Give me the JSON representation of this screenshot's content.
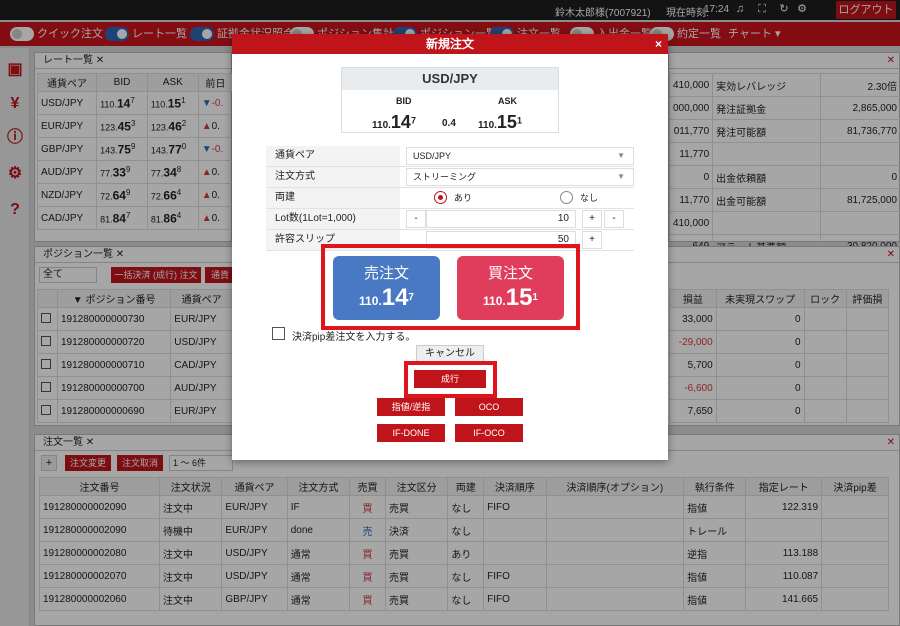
{
  "topbar": {
    "user": "鈴木太郎様(7007921)",
    "time_label": "現在時刻:",
    "time": "17:24",
    "logout": "ログアウト"
  },
  "toolbar": {
    "toggles": [
      {
        "label": "クイック注文",
        "on": false
      },
      {
        "label": "レート一覧",
        "on": true
      },
      {
        "label": "証拠金状況照会",
        "on": true
      },
      {
        "label": "ポジション集計",
        "on": false
      },
      {
        "label": "ポジション一覧",
        "on": true
      },
      {
        "label": "注文一覧",
        "on": true
      },
      {
        "label": "入出金一覧",
        "on": false
      },
      {
        "label": "約定一覧",
        "on": false
      }
    ],
    "chart": "チャート"
  },
  "rates": {
    "title": "レート一覧",
    "headers": [
      "通貨ペア",
      "BID",
      "ASK",
      "前日"
    ],
    "rows": [
      {
        "pair": "USD/JPY",
        "bid_big": "110.",
        "bid_small": "14",
        "bid_sup": "7",
        "ask_big": "110.",
        "ask_small": "15",
        "ask_sup": "1",
        "dir": "down",
        "chg": "-0."
      },
      {
        "pair": "EUR/JPY",
        "bid_big": "123.",
        "bid_small": "45",
        "bid_sup": "3",
        "ask_big": "123.",
        "ask_small": "46",
        "ask_sup": "2",
        "dir": "up",
        "chg": "0."
      },
      {
        "pair": "GBP/JPY",
        "bid_big": "143.",
        "bid_small": "75",
        "bid_sup": "9",
        "ask_big": "143.",
        "ask_small": "77",
        "ask_sup": "0",
        "dir": "down",
        "chg": "-0."
      },
      {
        "pair": "AUD/JPY",
        "bid_big": "77.",
        "bid_small": "33",
        "bid_sup": "9",
        "ask_big": "77.",
        "ask_small": "34",
        "ask_sup": "8",
        "dir": "up",
        "chg": "0."
      },
      {
        "pair": "NZD/JPY",
        "bid_big": "72.",
        "bid_small": "64",
        "bid_sup": "9",
        "ask_big": "72.",
        "ask_small": "66",
        "ask_sup": "4",
        "dir": "up",
        "chg": "0."
      },
      {
        "pair": "CAD/JPY",
        "bid_big": "81.",
        "bid_small": "84",
        "bid_sup": "7",
        "ask_big": "81.",
        "ask_small": "86",
        "ask_sup": "4",
        "dir": "up",
        "chg": "0."
      }
    ]
  },
  "margin": {
    "rows": [
      {
        "v1": "410,000",
        "k2": "実効レバレッジ",
        "v2": "2.30倍"
      },
      {
        "v1": "000,000",
        "k2": "発注証拠金",
        "v2": "2,865,000"
      },
      {
        "v1": "011,770",
        "k2": "発注可能額",
        "v2": "81,736,770"
      },
      {
        "v1": "11,770",
        "k2": "",
        "v2": ""
      },
      {
        "v1": "0",
        "k2": "出金依頼額",
        "v2": "0"
      },
      {
        "v1": "11,770",
        "k2": "出金可能額",
        "v2": "81,725,000"
      },
      {
        "v1": "410,000",
        "k2": "",
        "v2": ""
      },
      {
        "v1": "649",
        "k2": "アラート基準額",
        "v2": "30,820,000"
      }
    ]
  },
  "positions": {
    "title": "ポジション一覧",
    "filter": "全て",
    "bulk_button": "一括決済 (成行) 注文",
    "currency_button": "通貨",
    "headers": [
      "▼ ポジション番号",
      "通貨ペア"
    ],
    "right_headers": [
      "損益",
      "未実現スワップ",
      "ロック",
      "評価損"
    ],
    "rows": [
      {
        "id": "191280000000730",
        "pair": "EUR/JPY",
        "pl": "33,000",
        "pl_neg": false,
        "swap": "0"
      },
      {
        "id": "191280000000720",
        "pair": "USD/JPY",
        "pl": "-29,000",
        "pl_neg": true,
        "swap": "0"
      },
      {
        "id": "191280000000710",
        "pair": "CAD/JPY",
        "pl": "5,700",
        "pl_neg": false,
        "swap": "0"
      },
      {
        "id": "191280000000700",
        "pair": "AUD/JPY",
        "pl": "-6,600",
        "pl_neg": true,
        "swap": "0"
      },
      {
        "id": "191280000000690",
        "pair": "EUR/JPY",
        "pl": "7,650",
        "pl_neg": false,
        "swap": "0"
      }
    ]
  },
  "orders": {
    "title": "注文一覧",
    "plus": "+",
    "change_button": "注文変更",
    "cancel_button": "注文取消",
    "count_select": "1 ～ 6件",
    "headers": [
      "注文番号",
      "注文状況",
      "通貨ペア",
      "注文方式",
      "売買",
      "注文区分",
      "両建",
      "決済順序",
      "決済順序(オプション)",
      "執行条件",
      "指定レート",
      "決済pip差"
    ],
    "rows": [
      {
        "id": "191280000002090",
        "status": "注文中",
        "pair": "EUR/JPY",
        "method": "IF",
        "side": "買",
        "kind": "売買",
        "hedge": "なし",
        "order": "FIFO",
        "cond": "指値",
        "rate": "122.319"
      },
      {
        "id": "191280000002090",
        "status": "待機中",
        "pair": "EUR/JPY",
        "method": "done",
        "side": "売",
        "kind": "決済",
        "hedge": "なし",
        "order": "",
        "cond": "トレール",
        "rate": ""
      },
      {
        "id": "191280000002080",
        "status": "注文中",
        "pair": "USD/JPY",
        "method": "通常",
        "side": "買",
        "kind": "売買",
        "hedge": "あり",
        "order": "",
        "cond": "逆指",
        "rate": "113.188"
      },
      {
        "id": "191280000002070",
        "status": "注文中",
        "pair": "USD/JPY",
        "method": "通常",
        "side": "買",
        "kind": "売買",
        "hedge": "なし",
        "order": "FIFO",
        "cond": "指値",
        "rate": "110.087"
      },
      {
        "id": "191280000002060",
        "status": "注文中",
        "pair": "GBP/JPY",
        "method": "通常",
        "side": "買",
        "kind": "売買",
        "hedge": "なし",
        "order": "FIFO",
        "cond": "指値",
        "rate": "141.665"
      }
    ]
  },
  "modal": {
    "title": "新規注文",
    "close": "×",
    "pair": "USD/JPY",
    "bid_label": "BID",
    "ask_label": "ASK",
    "bid_big": "110.",
    "bid_small": "14",
    "bid_sup": "7",
    "ask_big": "110.",
    "ask_small": "15",
    "ask_sup": "1",
    "spread": "0.4",
    "rows": {
      "pair_label": "通貨ペア",
      "pair_value": "USD/JPY",
      "method_label": "注文方式",
      "method_value": "ストリーミング",
      "hedge_label": "両建",
      "hedge_yes": "あり",
      "hedge_no": "なし",
      "lot_label": "Lot数(1Lot=1,000)",
      "lot_minus": "-",
      "lot_value": "10",
      "lot_plus": "+",
      "lot_minus2": "-",
      "slip_label": "許容スリップ",
      "slip_value": "50",
      "slip_plus": "+"
    },
    "sell_label": "売注文",
    "sell_big": "110.",
    "sell_small": "14",
    "sell_sup": "7",
    "buy_label": "買注文",
    "buy_big": "110.",
    "buy_small": "15",
    "buy_sup": "1",
    "settle_checkbox": "決済pip差注文を入力する。",
    "cancel": "キャンセル",
    "market": "成行",
    "limit_stop": "指値/逆指",
    "oco": "OCO",
    "ifdone": "IF-DONE",
    "ifoco": "IF-OCO"
  },
  "colors": {
    "accent": "#c0141b",
    "sell": "#4a79c3",
    "buy": "#e03c5c",
    "frame": "#e0141b"
  }
}
